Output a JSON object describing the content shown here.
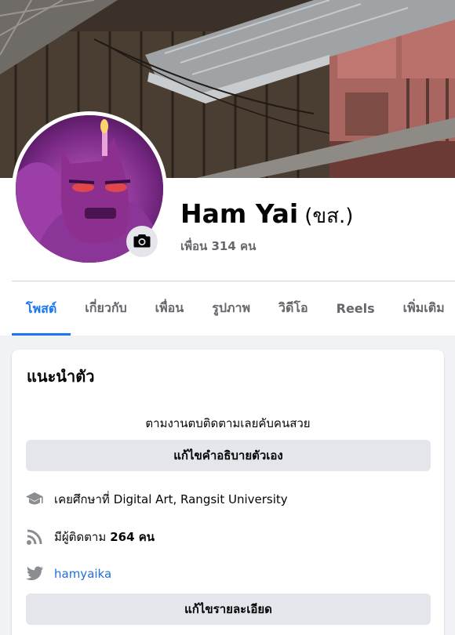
{
  "profile": {
    "name": "Ham Yai",
    "nickname": "(ขส.)",
    "friends_text": "เพื่อน 314 คน"
  },
  "tabs": [
    {
      "label": "โพสต์",
      "active": true
    },
    {
      "label": "เกี่ยวกับ",
      "active": false
    },
    {
      "label": "เพื่อน",
      "active": false
    },
    {
      "label": "รูปภาพ",
      "active": false
    },
    {
      "label": "วิดีโอ",
      "active": false
    },
    {
      "label": "Reels",
      "active": false
    },
    {
      "label": "เพิ่มเติม",
      "active": false
    }
  ],
  "intro": {
    "title": "แนะนำตัว",
    "bio": "ตามงานตบติดตามเลยคับคนสวย",
    "edit_bio_label": "แก้ไขคำอธิบายตัวเอง",
    "education_prefix": "เคยศึกษาที่",
    "education_school": "Digital Art, Rangsit University",
    "followers_prefix": "มีผู้ติดตาม",
    "followers_count": "264 คน",
    "twitter_handle": "hamyaika",
    "edit_details_label": "แก้ไขรายละเอียด",
    "icons": {
      "education": "graduation-cap-icon",
      "followers": "rss-icon",
      "twitter": "twitter-bird-icon",
      "camera": "camera-icon"
    }
  },
  "colors": {
    "accent": "#1877f2",
    "link": "#216fdb",
    "secondary_text": "#65676b",
    "button_gray": "#e4e6eb",
    "page_bg": "#f0f2f5"
  }
}
